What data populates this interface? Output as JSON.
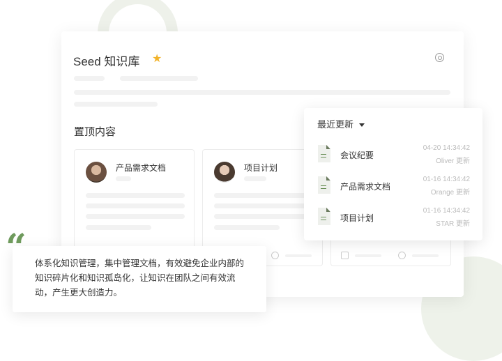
{
  "header": {
    "title": "Seed 知识库",
    "star_icon": "star-icon",
    "settings_icon": "gear-icon"
  },
  "pinned": {
    "title": "置顶内容",
    "cards": [
      {
        "title": "产品需求文档"
      },
      {
        "title": "项目计划"
      }
    ]
  },
  "recent": {
    "title": "最近更新",
    "items": [
      {
        "name": "会议纪要",
        "time": "04-20 14:34:42",
        "by": "Oliver 更新"
      },
      {
        "name": "产品需求文档",
        "time": "01-16 14:34:42",
        "by": "Orange 更新"
      },
      {
        "name": "项目计划",
        "time": "01-16 14:34:42",
        "by": "STAR 更新"
      }
    ]
  },
  "quote": {
    "mark": "“",
    "text": "体系化知识管理，集中管理文档，有效避免企业内部的知识碎片化和知识孤岛化，让知识在团队之间有效流动，产生更大创造力。"
  },
  "colors": {
    "accent": "#6e9a5c",
    "star": "#f2b32a"
  }
}
